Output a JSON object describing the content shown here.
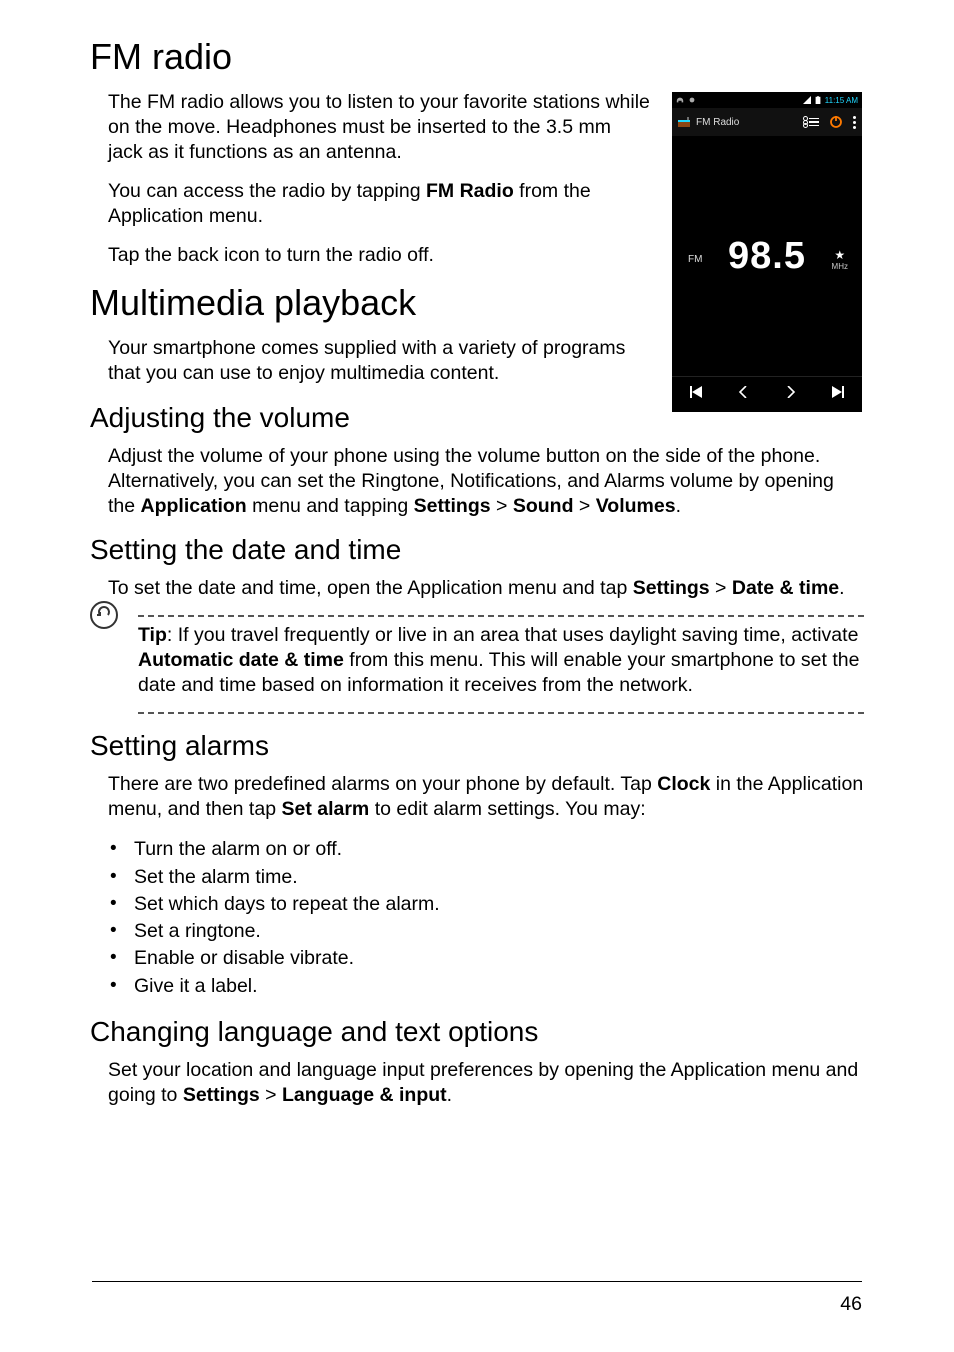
{
  "page_number": "46",
  "h1_fm": "FM radio",
  "fm_p1": "The FM radio allows you to listen to your favorite stations while on the move. Headphones must be inserted to the 3.5 mm jack as it functions as an antenna.",
  "fm_p2a": "You can access the radio by tapping ",
  "fm_p2b": "FM Radio",
  "fm_p2c": " from the Application menu.",
  "fm_p3": "Tap the back icon to turn the radio off.",
  "h1_mm": "Multimedia playback",
  "mm_p1": "Your smartphone comes supplied with a variety of programs that you can use to enjoy multimedia content.",
  "h2_vol": "Adjusting the volume",
  "vol_p1a": "Adjust the volume of your phone using the volume button on the side of the phone. Alternatively, you can set the Ringtone, Notifications, and Alarms volume by opening the ",
  "vol_p1b": "Application",
  "vol_p1c": " menu and tapping ",
  "vol_p1d": "Settings",
  "vol_gt1": " > ",
  "vol_p1e": "Sound",
  "vol_gt2": " > ",
  "vol_p1f": "Volumes",
  "vol_p1g": ".",
  "h2_dt": "Setting the date and time",
  "dt_p1a": "To set the date and time, open the Application menu and tap ",
  "dt_p1b": "Settings",
  "dt_gt1": " > ",
  "dt_p1c": "Date & time",
  "dt_p1d": ".",
  "tip_label": "Tip",
  "tip_p1a": ": If you travel frequently or live in an area that uses daylight saving time, activate ",
  "tip_p1b": "Automatic date & time",
  "tip_p1c": " from this menu. This will enable your smartphone to set the date and time based on information it receives from the network.",
  "h2_al": "Setting alarms",
  "al_p1a": "There are two predefined alarms on your phone by default. Tap ",
  "al_p1b": "Clock",
  "al_p1c": " in the Application menu, and then tap ",
  "al_p1d": "Set alarm",
  "al_p1e": " to edit alarm settings. You may:",
  "al_li": {
    "0": "Turn the alarm on or off.",
    "1": "Set the alarm time.",
    "2": "Set which days to repeat the alarm.",
    "3": "Set a ringtone.",
    "4": "Enable or disable vibrate.",
    "5": "Give it a label."
  },
  "h2_lang": "Changing language and text options",
  "lang_p1a": "Set your location and language input preferences by opening the Application menu and going to ",
  "lang_p1b": "Settings",
  "lang_gt1": " > ",
  "lang_p1c": "Language & input",
  "lang_p1d": ".",
  "phone": {
    "status_time": "11:15 AM",
    "app_title": "FM Radio",
    "fm_label": "FM",
    "frequency": "98.5",
    "mhz": "MHz",
    "star": "★"
  }
}
